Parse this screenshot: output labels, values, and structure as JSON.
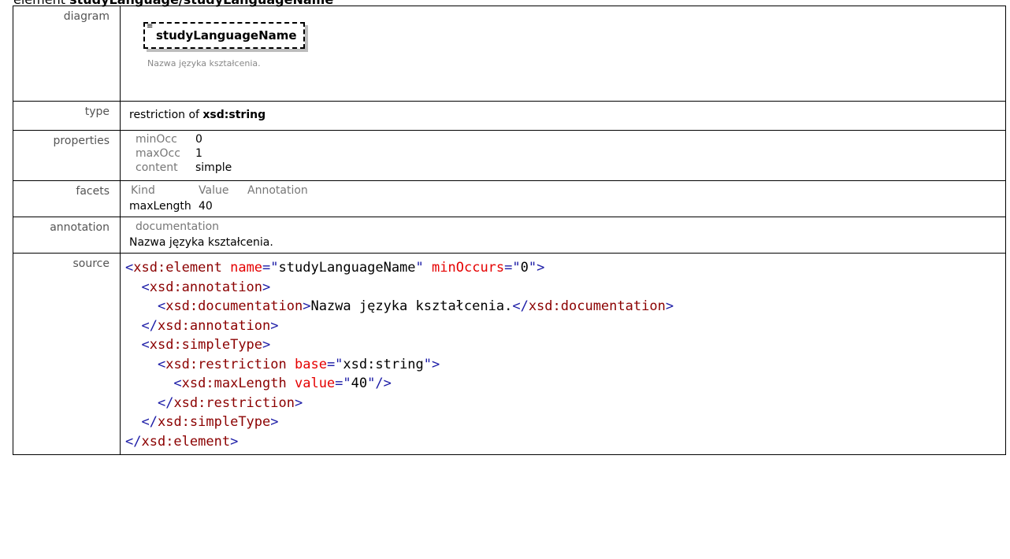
{
  "header": {
    "prefix": "element",
    "path": "studyLanguage/studyLanguageName"
  },
  "rows": {
    "diagram": {
      "label": "diagram",
      "element_name": "studyLanguageName",
      "doc": "Nazwa języka kształcenia."
    },
    "type": {
      "label": "type",
      "prefix": "restriction of",
      "base": "xsd:string"
    },
    "properties": {
      "label": "properties",
      "items": [
        {
          "key": "minOcc",
          "value": "0"
        },
        {
          "key": "maxOcc",
          "value": "1"
        },
        {
          "key": "content",
          "value": "simple"
        }
      ]
    },
    "facets": {
      "label": "facets",
      "headers": [
        "Kind",
        "Value",
        "Annotation"
      ],
      "rows": [
        {
          "kind": "maxLength",
          "value": "40",
          "annotation": ""
        }
      ]
    },
    "annotation": {
      "label": "annotation",
      "key": "documentation",
      "text": "Nazwa języka kształcenia."
    },
    "source": {
      "label": "source",
      "element_name": "studyLanguageName",
      "min_occurs": "0",
      "documentation": "Nazwa języka kształcenia.",
      "base": "xsd:string",
      "max_length": "40"
    }
  },
  "colors": {
    "tag": "#8b0000",
    "attr": "#e50000",
    "bracket": "#1a1aa6"
  }
}
